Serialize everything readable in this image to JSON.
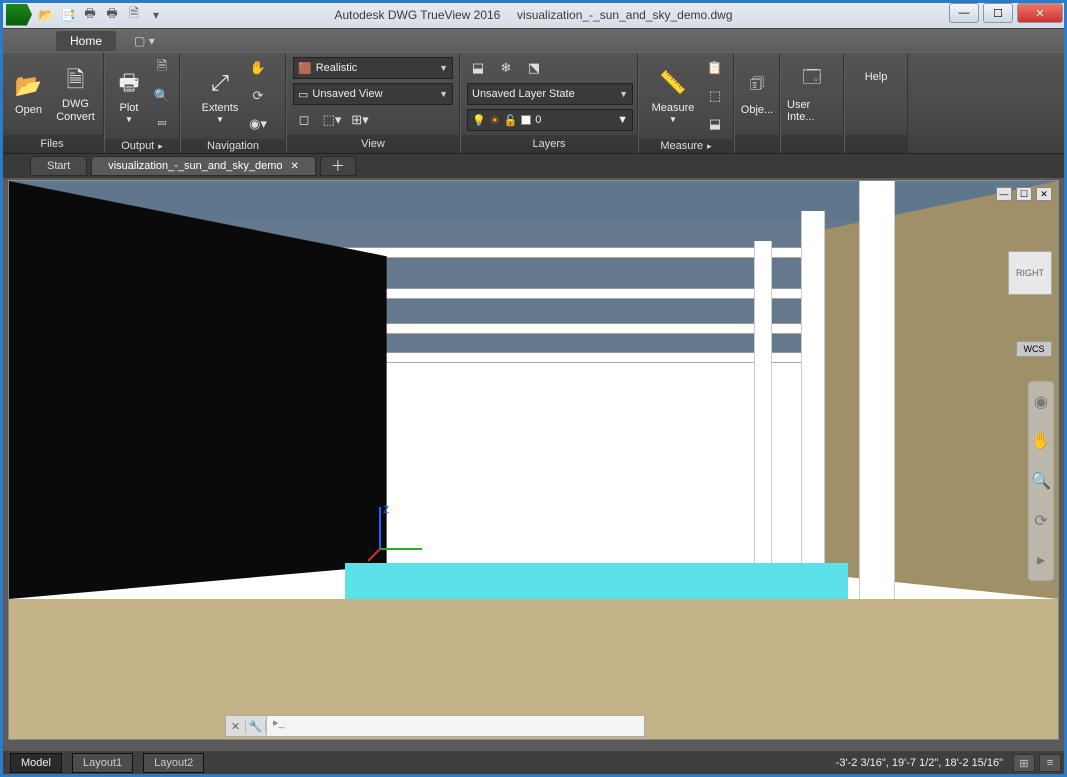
{
  "titlebar": {
    "app_name": "Autodesk DWG TrueView 2016",
    "file_name": "visualization_-_sun_and_sky_demo.dwg"
  },
  "ribbon": {
    "tabs": {
      "home": "Home"
    },
    "files": {
      "open": "Open",
      "dwg_convert": "DWG\nConvert",
      "label": "Files"
    },
    "output": {
      "plot": "Plot",
      "label": "Output"
    },
    "navigation": {
      "extents": "Extents",
      "label": "Navigation"
    },
    "view": {
      "visual_style": "Realistic",
      "saved_view": "Unsaved View",
      "label": "View"
    },
    "layers": {
      "state": "Unsaved Layer State",
      "current": "0",
      "label": "Layers"
    },
    "measure": {
      "measure": "Measure",
      "label": "Measure"
    },
    "props": {
      "obj": "Obje..."
    },
    "ui": {
      "userint": "User Inte..."
    },
    "help": {
      "help": "Help"
    }
  },
  "filetabs": {
    "start": "Start",
    "file": "visualization_-_sun_and_sky_demo"
  },
  "viewport": {
    "viewcube": "RIGHT",
    "wcs": "WCS"
  },
  "bottom": {
    "model": "Model",
    "layout1": "Layout1",
    "layout2": "Layout2",
    "coords": "-3'-2 3/16\", 19'-7 1/2\", 18'-2 15/16\""
  }
}
